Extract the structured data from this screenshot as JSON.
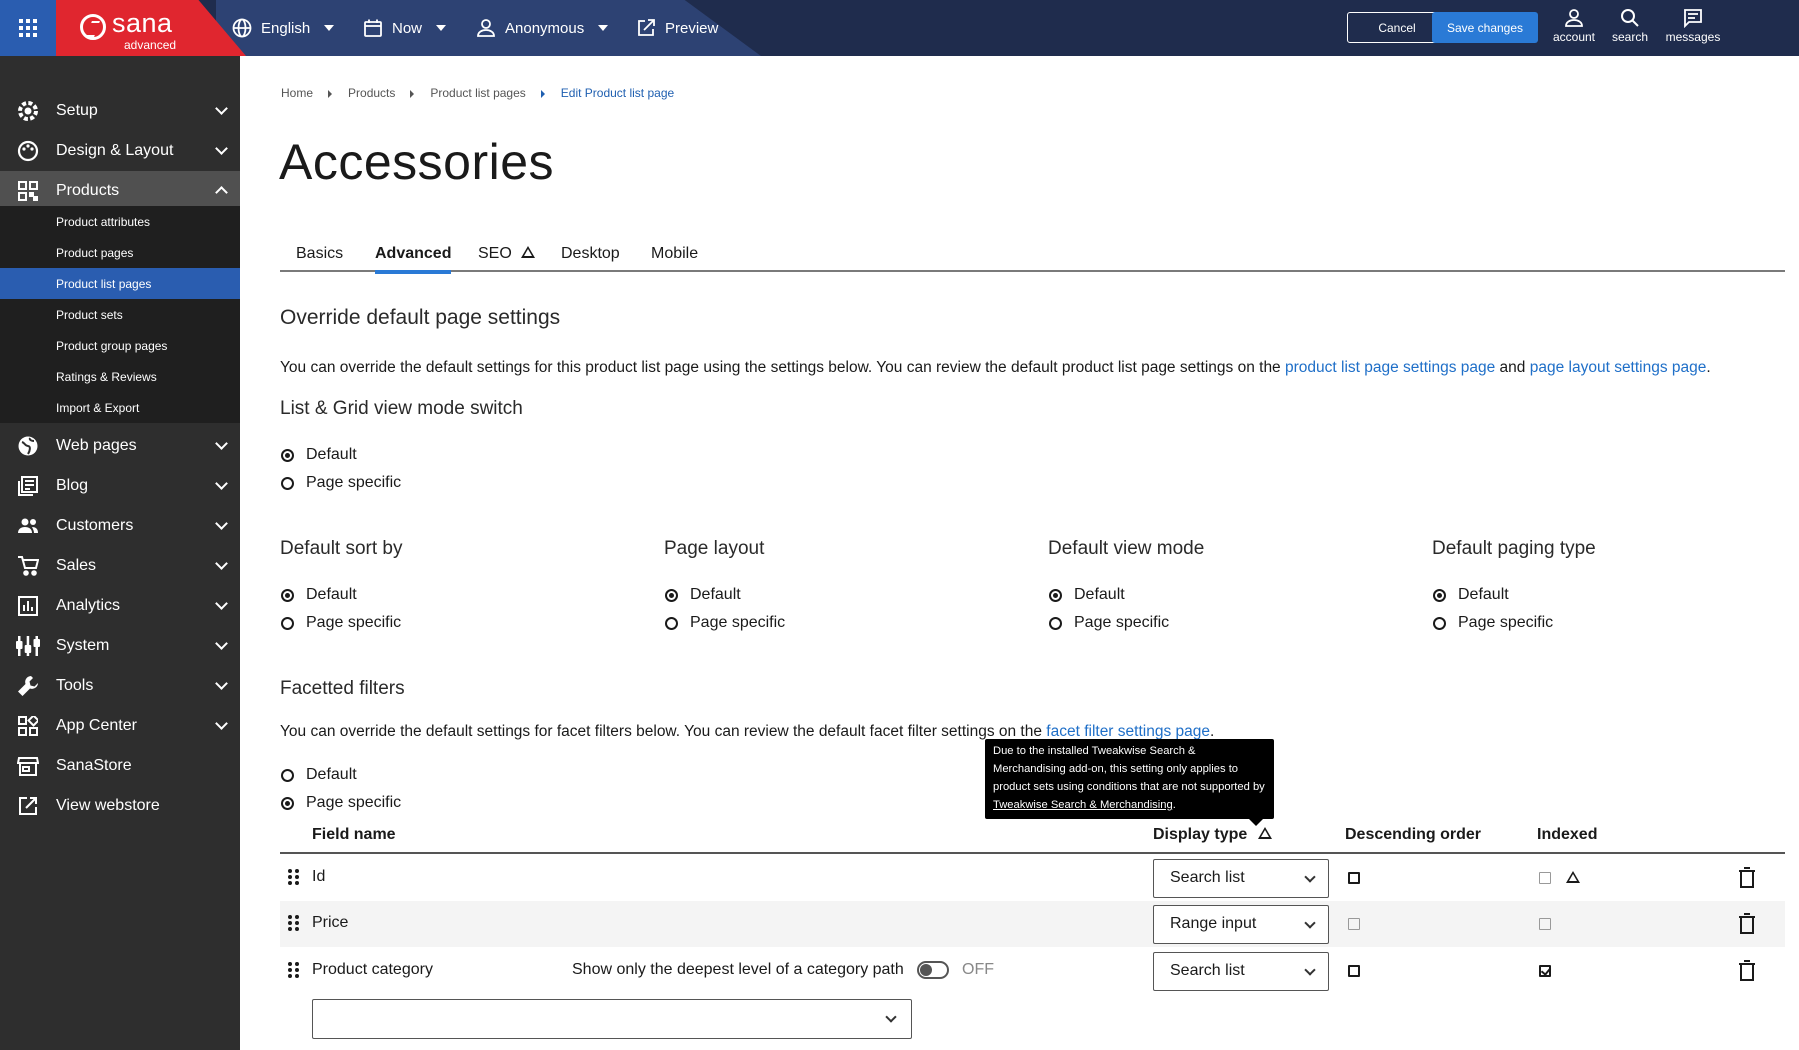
{
  "topbar": {
    "logo_name": "sana",
    "logo_sub": "advanced",
    "language": "English",
    "date": "Now",
    "user": "Anonymous",
    "preview": "Preview",
    "cancel": "Cancel",
    "save": "Save changes",
    "account": "account",
    "search": "search",
    "messages": "messages"
  },
  "sidebar": {
    "items": [
      {
        "label": "Setup",
        "icon": "gear-icon"
      },
      {
        "label": "Design & Layout",
        "icon": "palette-icon"
      },
      {
        "label": "Products",
        "icon": "qr-grid-icon"
      },
      {
        "label": "Web pages",
        "icon": "globe-icon"
      },
      {
        "label": "Blog",
        "icon": "newspaper-icon"
      },
      {
        "label": "Customers",
        "icon": "people-icon"
      },
      {
        "label": "Sales",
        "icon": "cart-icon"
      },
      {
        "label": "Analytics",
        "icon": "bar-chart-icon"
      },
      {
        "label": "System",
        "icon": "sliders-icon"
      },
      {
        "label": "Tools",
        "icon": "wrench-icon"
      },
      {
        "label": "App Center",
        "icon": "apps-icon"
      },
      {
        "label": "SanaStore",
        "icon": "store-icon"
      },
      {
        "label": "View webstore",
        "icon": "external-link-icon"
      }
    ],
    "sub_items": [
      "Product attributes",
      "Product pages",
      "Product list pages",
      "Product sets",
      "Product group pages",
      "Ratings & Reviews",
      "Import & Export"
    ]
  },
  "breadcrumb": [
    "Home",
    "Products",
    "Product list pages",
    "Edit Product list page"
  ],
  "page_title": "Accessories",
  "tabs": [
    "Basics",
    "Advanced",
    "SEO",
    "Desktop",
    "Mobile"
  ],
  "override": {
    "heading": "Override default page settings",
    "text_before": "You can override the default settings for this product list page using the settings below. You can review the default product list page settings on the ",
    "link1": "product list page settings page",
    "and": " and ",
    "link2": "page layout settings page",
    "period": "."
  },
  "view_switch": {
    "heading": "List & Grid view mode switch"
  },
  "options": {
    "default": "Default",
    "page_specific": "Page specific"
  },
  "groups": {
    "sort": "Default sort by",
    "layout": "Page layout",
    "view_mode": "Default view mode",
    "paging": "Default paging type"
  },
  "facets": {
    "heading": "Facetted filters",
    "text_before": "You can override the default settings for facet filters below. You can review the default facet filter settings on the ",
    "link": "facet filter settings page",
    "period": "."
  },
  "table": {
    "headers": {
      "field": "Field name",
      "display": "Display type",
      "desc": "Descending order",
      "indexed": "Indexed"
    },
    "rows": [
      {
        "name": "Id",
        "display": "Search list",
        "descending": false,
        "indexed": false
      },
      {
        "name": "Price",
        "display": "Range input",
        "descending": false,
        "indexed": false
      },
      {
        "name": "Product category",
        "display": "Search list",
        "descending": false,
        "indexed": true
      }
    ],
    "deepest_label": "Show only the deepest level of a category path",
    "toggle_state": "OFF"
  },
  "tooltip": {
    "text": "Due to the installed Tweakwise Search & Merchandising add-on, this setting only applies to product sets using conditions that are not supported by ",
    "link": "Tweakwise Search & Merchandising",
    "period": "."
  }
}
